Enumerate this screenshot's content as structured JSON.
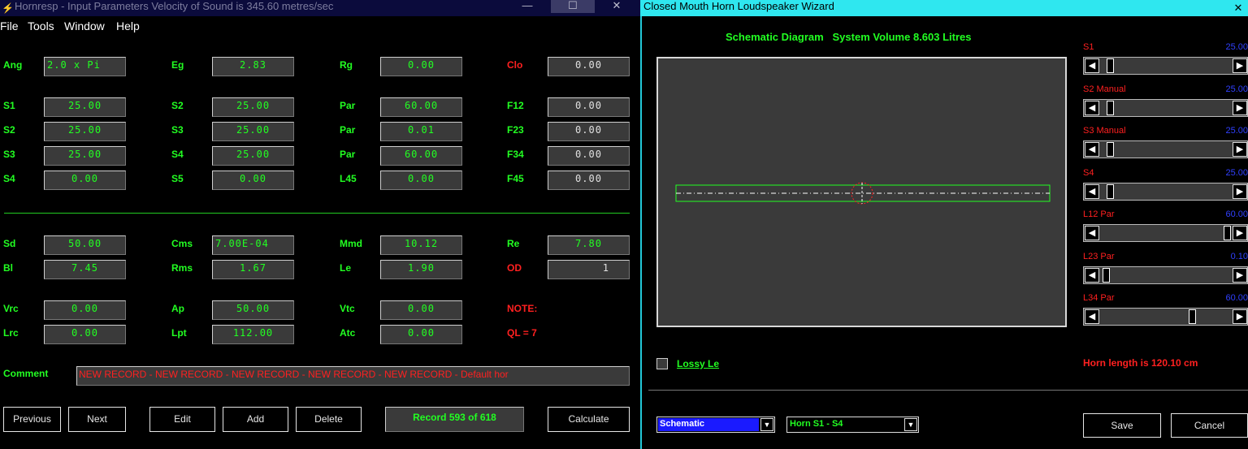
{
  "left_window": {
    "title": "Hornresp - Input Parameters   Velocity of Sound is 345.60 metres/sec",
    "controls": {
      "minimize": "—",
      "maximize": "☐",
      "close": "✕"
    },
    "menu": [
      "File",
      "Tools",
      "Window",
      "Help"
    ],
    "fields": {
      "ang": {
        "label": "Ang",
        "value": "2.0 x Pi"
      },
      "eg": {
        "label": "Eg",
        "value": "2.83"
      },
      "rg": {
        "label": "Rg",
        "value": "0.00"
      },
      "clo": {
        "label": "Clo",
        "value": "0.00"
      },
      "s1a": {
        "label": "S1",
        "value": "25.00"
      },
      "s2a": {
        "label": "S2",
        "value": "25.00"
      },
      "par1": {
        "label": "Par",
        "value": "60.00"
      },
      "f12": {
        "label": "F12",
        "value": "0.00"
      },
      "s2b": {
        "label": "S2",
        "value": "25.00"
      },
      "s3a": {
        "label": "S3",
        "value": "25.00"
      },
      "par2": {
        "label": "Par",
        "value": "0.01"
      },
      "f23": {
        "label": "F23",
        "value": "0.00"
      },
      "s3b": {
        "label": "S3",
        "value": "25.00"
      },
      "s4a": {
        "label": "S4",
        "value": "25.00"
      },
      "par3": {
        "label": "Par",
        "value": "60.00"
      },
      "f34": {
        "label": "F34",
        "value": "0.00"
      },
      "s4b": {
        "label": "S4",
        "value": "0.00"
      },
      "s5": {
        "label": "S5",
        "value": "0.00"
      },
      "l45": {
        "label": "L45",
        "value": "0.00"
      },
      "f45": {
        "label": "F45",
        "value": "0.00"
      },
      "sd": {
        "label": "Sd",
        "value": "50.00"
      },
      "cms": {
        "label": "Cms",
        "value": "7.00E-04"
      },
      "mmd": {
        "label": "Mmd",
        "value": "10.12"
      },
      "re": {
        "label": "Re",
        "value": "7.80"
      },
      "bl": {
        "label": "Bl",
        "value": "7.45"
      },
      "rms": {
        "label": "Rms",
        "value": "1.67"
      },
      "le": {
        "label": "Le",
        "value": "1.90"
      },
      "od": {
        "label": "OD",
        "value": "1"
      },
      "vrc": {
        "label": "Vrc",
        "value": "0.00"
      },
      "ap": {
        "label": "Ap",
        "value": "50.00"
      },
      "vtc": {
        "label": "Vtc",
        "value": "0.00"
      },
      "lrc": {
        "label": "Lrc",
        "value": "0.00"
      },
      "lpt": {
        "label": "Lpt",
        "value": "112.00"
      },
      "atc": {
        "label": "Atc",
        "value": "0.00"
      }
    },
    "note_label": "NOTE:",
    "ql_label": "QL = 7",
    "comment_label": "Comment",
    "comment_value": "NEW RECORD - NEW RECORD - NEW RECORD - NEW RECORD - NEW RECORD - Default hor",
    "buttons": {
      "previous": "Previous",
      "next": "Next",
      "edit": "Edit",
      "add": "Add",
      "delete": "Delete",
      "calculate": "Calculate"
    },
    "record": "Record 593 of 618"
  },
  "wizard": {
    "title": "Closed Mouth Horn Loudspeaker Wizard",
    "close": "✕",
    "schematic_title": "Schematic Diagram   System Volume 8.603 Litres",
    "sliders": [
      {
        "label": "S1",
        "value": "25.00",
        "position": 0.05
      },
      {
        "label": "S2  Manual",
        "value": "25.00",
        "position": 0.05
      },
      {
        "label": "S3  Manual",
        "value": "25.00",
        "position": 0.05
      },
      {
        "label": "S4",
        "value": "25.00",
        "position": 0.05
      },
      {
        "label": "L12  Par",
        "value": "60.00",
        "position": 0.99
      },
      {
        "label": "L23  Par",
        "value": "0.10",
        "position": 0.02
      },
      {
        "label": "L34  Par",
        "value": "60.00",
        "position": 0.71
      }
    ],
    "lossy_label": "Lossy Le",
    "horn_length": "Horn length is 120.10 cm",
    "dropdown_view": "Schematic",
    "dropdown_section": "Horn S1 - S4",
    "save": "Save",
    "cancel": "Cancel",
    "colors": {
      "accent_cyan": "#2fe7ef",
      "text_green": "#22ff22",
      "text_red": "#ff2020",
      "value_blue": "#3040ff"
    }
  }
}
